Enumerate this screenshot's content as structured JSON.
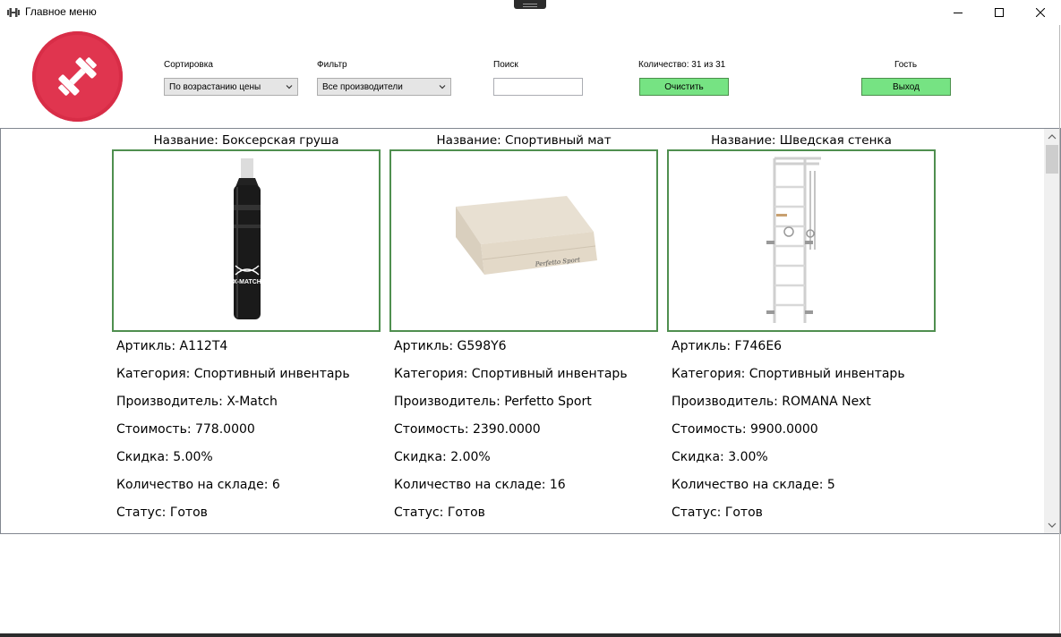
{
  "window": {
    "title": "Главное меню",
    "icons": {
      "app": "dumbbell-icon",
      "minimize": "minimize-icon",
      "maximize": "maximize-icon",
      "close": "close-icon"
    }
  },
  "header": {
    "sort": {
      "label": "Сортировка",
      "value": "По возрастанию цены"
    },
    "filter": {
      "label": "Фильтр",
      "value": "Все производители"
    },
    "search": {
      "label": "Поиск",
      "value": ""
    },
    "count": {
      "label": "Количество: 31 из 31",
      "clear_label": "Очистить"
    },
    "user": {
      "label": "Гость",
      "exit_label": "Выход"
    },
    "colors": {
      "logo": "#e0354f",
      "button": "#76e383",
      "card_border": "#4f8f4f"
    }
  },
  "products": [
    {
      "name": "Название: Боксерская груша",
      "image": "punching-bag-image",
      "article": "Артикль: А112Т4",
      "category": "Категория: Спортивный инвентарь",
      "manufacturer": "Производитель: X-Match",
      "price": "Стоимость: 778.0000",
      "discount": "Скидка: 5.00%",
      "stock": "Количество на складе: 6",
      "status": "Статус: Готов",
      "brand_text": "X-MATCH"
    },
    {
      "name": "Название: Спортивный мат",
      "image": "sport-mat-image",
      "article": "Артикль: G598Y6",
      "category": "Категория: Спортивный инвентарь",
      "manufacturer": "Производитель: Perfetto Sport",
      "price": "Стоимость: 2390.0000",
      "discount": "Скидка: 2.00%",
      "stock": "Количество на складе: 16",
      "status": "Статус: Готов",
      "brand_text": "Perfetto Sport"
    },
    {
      "name": "Название: Шведская стенка",
      "image": "wall-bars-image",
      "article": "Артикль: F746E6",
      "category": "Категория: Спортивный инвентарь",
      "manufacturer": "Производитель: ROMANA Next",
      "price": "Стоимость: 9900.0000",
      "discount": "Скидка: 3.00%",
      "stock": "Количество на складе: 5",
      "status": "Статус: Готов"
    }
  ]
}
